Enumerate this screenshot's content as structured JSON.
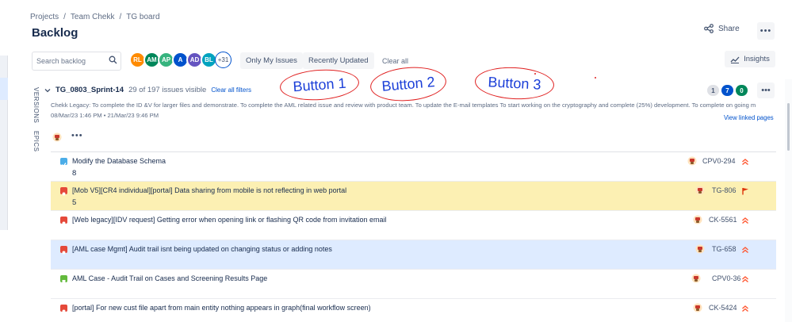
{
  "breadcrumb": {
    "items": [
      "Projects",
      "Team Chekk",
      "TG board"
    ],
    "separator": "/"
  },
  "page_title": "Backlog",
  "header": {
    "share_label": "Share",
    "more_label": "•••"
  },
  "toolbar": {
    "search_placeholder": "Search backlog",
    "avatars": [
      {
        "initials": "RL",
        "color": "#ff8b00"
      },
      {
        "initials": "AM",
        "color": "#00875a"
      },
      {
        "initials": "AP",
        "color": "#36b37e"
      },
      {
        "initials": "A",
        "color": "#0052cc"
      },
      {
        "initials": "AD",
        "color": "#6554c0"
      },
      {
        "initials": "BL",
        "color": "#00a3bf"
      }
    ],
    "more_avatars": "+31",
    "only_my_issues": "Only My Issues",
    "recently_updated": "Recently Updated",
    "clear_all": "Clear all",
    "insights_label": "Insights"
  },
  "side_tabs": {
    "versions": "VERSIONS",
    "epics": "EPICS"
  },
  "annotations": {
    "button1": "Button 1",
    "button2": "Button 2",
    "button3": "Button 3"
  },
  "sprint": {
    "name": "TG_0803_Sprint-14",
    "visible_count": "29 of 197 issues visible",
    "clear_filters": "Clear all filters",
    "status_counts": [
      {
        "value": "1",
        "bg": "#dfe1e6",
        "fg": "#42526e"
      },
      {
        "value": "7",
        "bg": "#0052cc",
        "fg": "#ffffff"
      },
      {
        "value": "0",
        "bg": "#00875a",
        "fg": "#ffffff"
      }
    ],
    "more_label": "•••",
    "goal": "Chekk Legacy: To complete the ID &V for larger files and demonstrate. To complete the AML related issue and review with product team. To update the E-mail templates To start working on the cryptography and complete (25%) development. To complete on going m",
    "dates": "08/Mar/23 1:46 PM  •  21/Mar/23 9:46 PM",
    "view_linked": "View linked pages",
    "dots": "•••"
  },
  "issues": [
    {
      "type": "task",
      "type_color": "#4bade8",
      "summary": "Modify the Database Schema",
      "points": "8",
      "key": "CPV0-294",
      "priority": "highest",
      "highlight": "none"
    },
    {
      "type": "bug",
      "type_color": "#e5493a",
      "summary": "[Mob V5][CR4 individual][portal] Data sharing from mobile is not reflecting in web portal",
      "points": "5",
      "key": "TG-806",
      "priority": "flag",
      "highlight": "yellow"
    },
    {
      "type": "bug",
      "type_color": "#e5493a",
      "summary": "[Web legacy][IDV request] Getting error when opening link or flashing QR code from invitation email",
      "points": "",
      "key": "CK-5561",
      "priority": "highest",
      "highlight": "none"
    },
    {
      "type": "bug",
      "type_color": "#e5493a",
      "summary": "[AML case Mgmt] Audit trail isnt being updated on changing status or adding notes",
      "points": "",
      "key": "TG-658",
      "priority": "highest",
      "highlight": "blue"
    },
    {
      "type": "story",
      "type_color": "#63ba3c",
      "summary": "AML Case - Audit Trail on Cases and Screening Results Page",
      "points": "",
      "key": "CPV0-36",
      "priority": "highest",
      "highlight": "none"
    },
    {
      "type": "bug",
      "type_color": "#e5493a",
      "summary": "[portal] For new cust file apart from main entity nothing appears in graph(final workflow screen)",
      "points": "",
      "key": "CK-5424",
      "priority": "highest",
      "highlight": "none"
    }
  ]
}
